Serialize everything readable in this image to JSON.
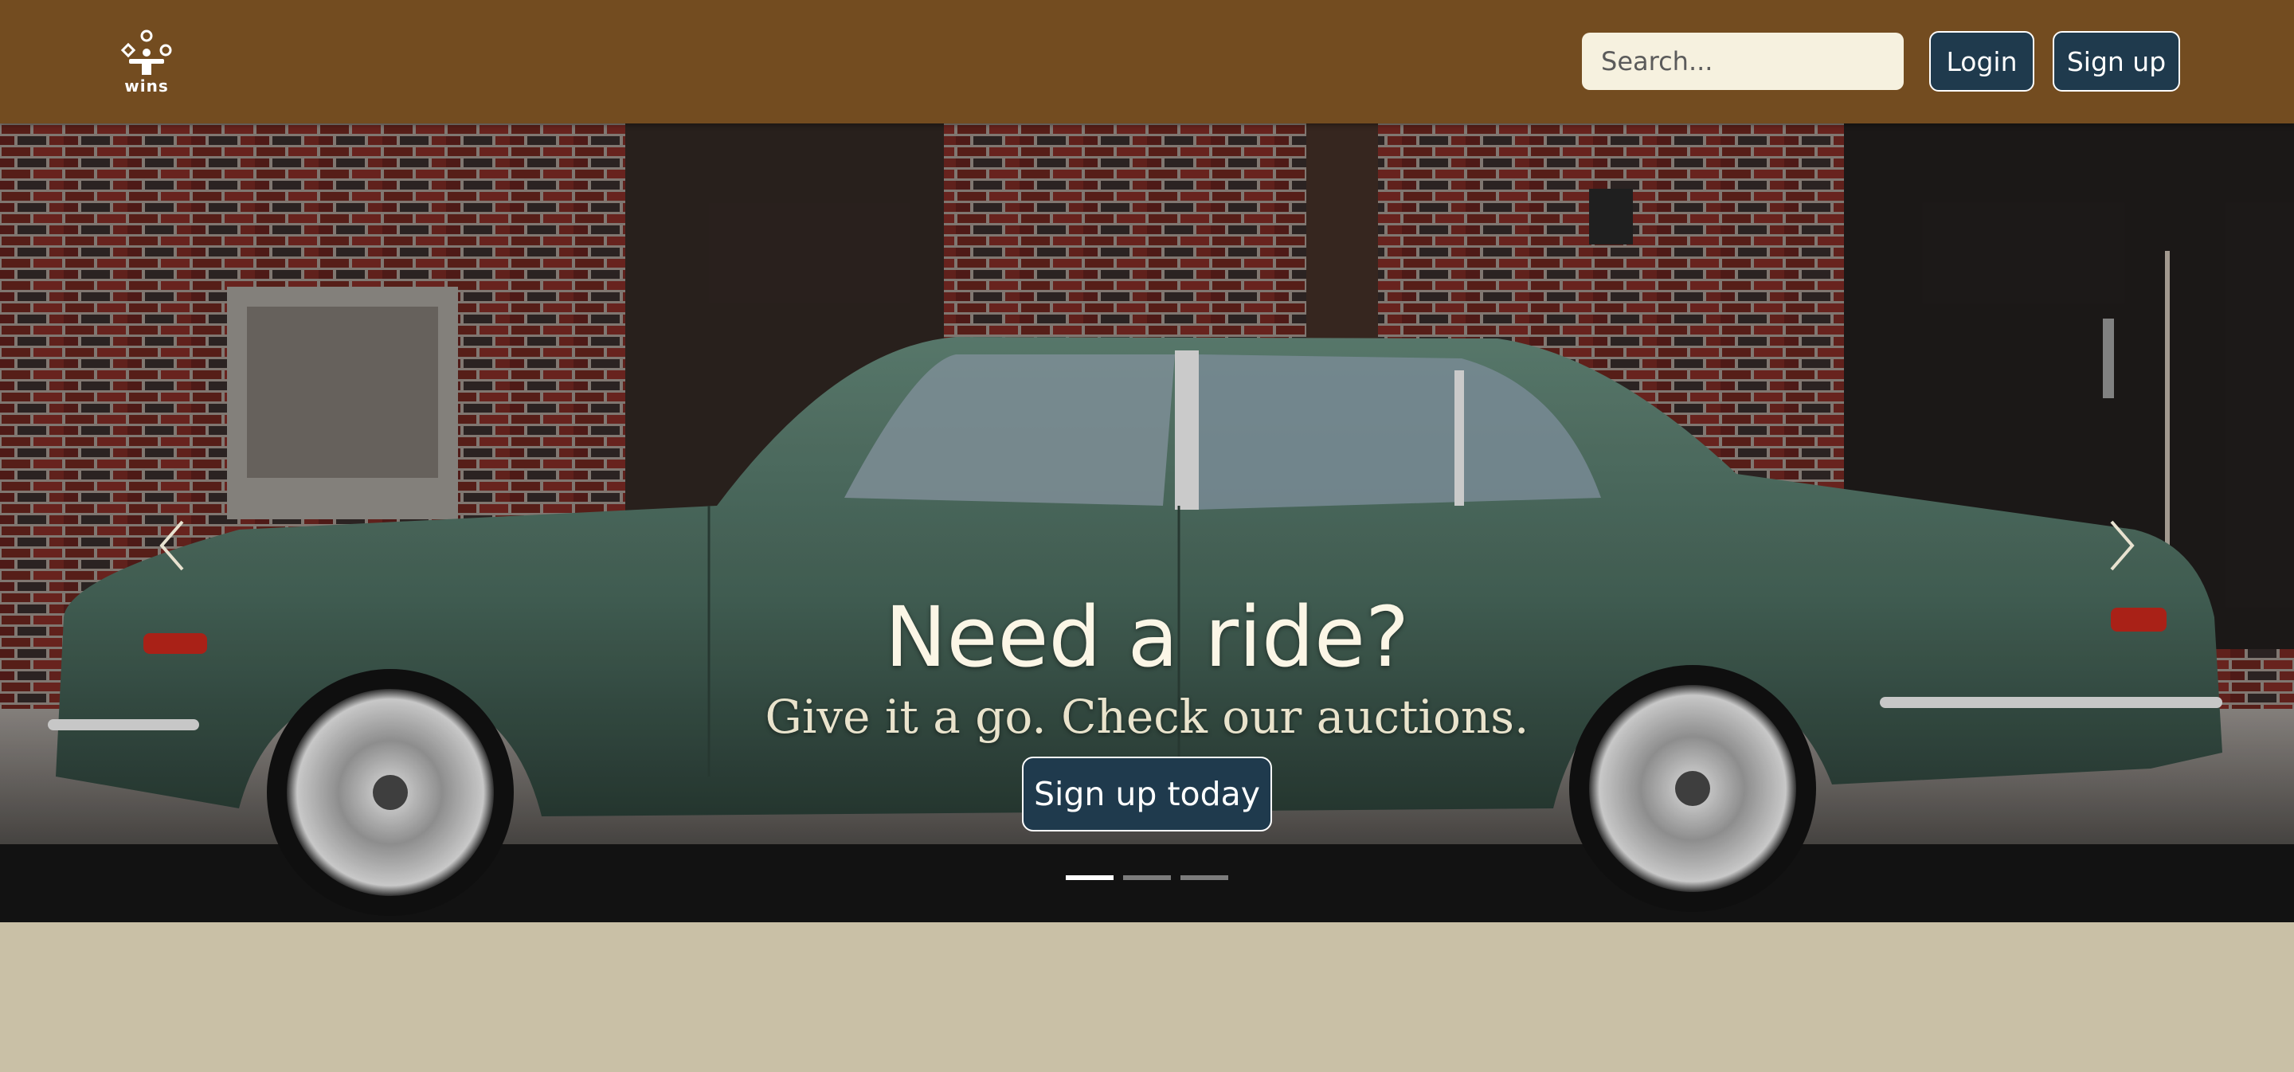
{
  "header": {
    "logo_text": "wins",
    "search": {
      "placeholder": "Search...",
      "value": ""
    },
    "login_label": "Login",
    "signup_label": "Sign up"
  },
  "hero": {
    "headline": "Need a ride?",
    "subheadline": "Give it a go. Check our auctions.",
    "cta_label": "Sign up today",
    "slide_count": 3,
    "active_slide": 1
  },
  "colors": {
    "navbar": "#734c20",
    "button": "#1f3a4d",
    "search_bg": "#f6f1df",
    "page_bg": "#c9c0a6"
  },
  "icons": [
    "prev-arrow-icon",
    "next-arrow-icon",
    "logo-icon"
  ]
}
